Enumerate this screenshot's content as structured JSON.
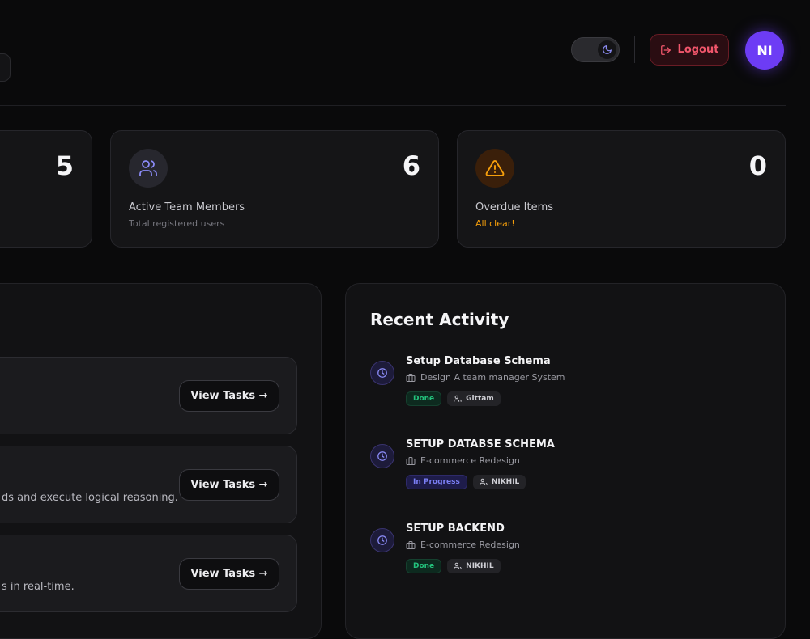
{
  "header": {
    "logout_label": "Logout",
    "avatar_initials": "NI"
  },
  "stats": [
    {
      "value": "5",
      "title": "",
      "subtitle": ""
    },
    {
      "value": "6",
      "title": "Active Team Members",
      "subtitle": "Total registered users"
    },
    {
      "value": "0",
      "title": "Overdue Items",
      "subtitle": "All clear!"
    }
  ],
  "projects": {
    "rows": [
      {
        "description": "",
        "button": "View Tasks →"
      },
      {
        "description": "ds and execute logical reasoning.",
        "button": "View Tasks →"
      },
      {
        "description": "s in real-time.",
        "button": "View Tasks →"
      }
    ]
  },
  "activity": {
    "title": "Recent Activity",
    "items": [
      {
        "name": "Setup Database Schema",
        "project": "Design A team manager System",
        "status": "Done",
        "user": "Gittam"
      },
      {
        "name": "SETUP DATABSE SCHEMA",
        "project": "E-commerce Redesign",
        "status": "In Progress",
        "user": "NIKHIL"
      },
      {
        "name": "SETUP BACKEND",
        "project": "E-commerce Redesign",
        "status": "Done",
        "user": "NIKHIL"
      }
    ]
  },
  "colors": {
    "accent": "#6d3cf5",
    "danger": "#f0566b",
    "success": "#23c27c",
    "progress": "#7b7ff5",
    "warning": "#f59e0b"
  }
}
